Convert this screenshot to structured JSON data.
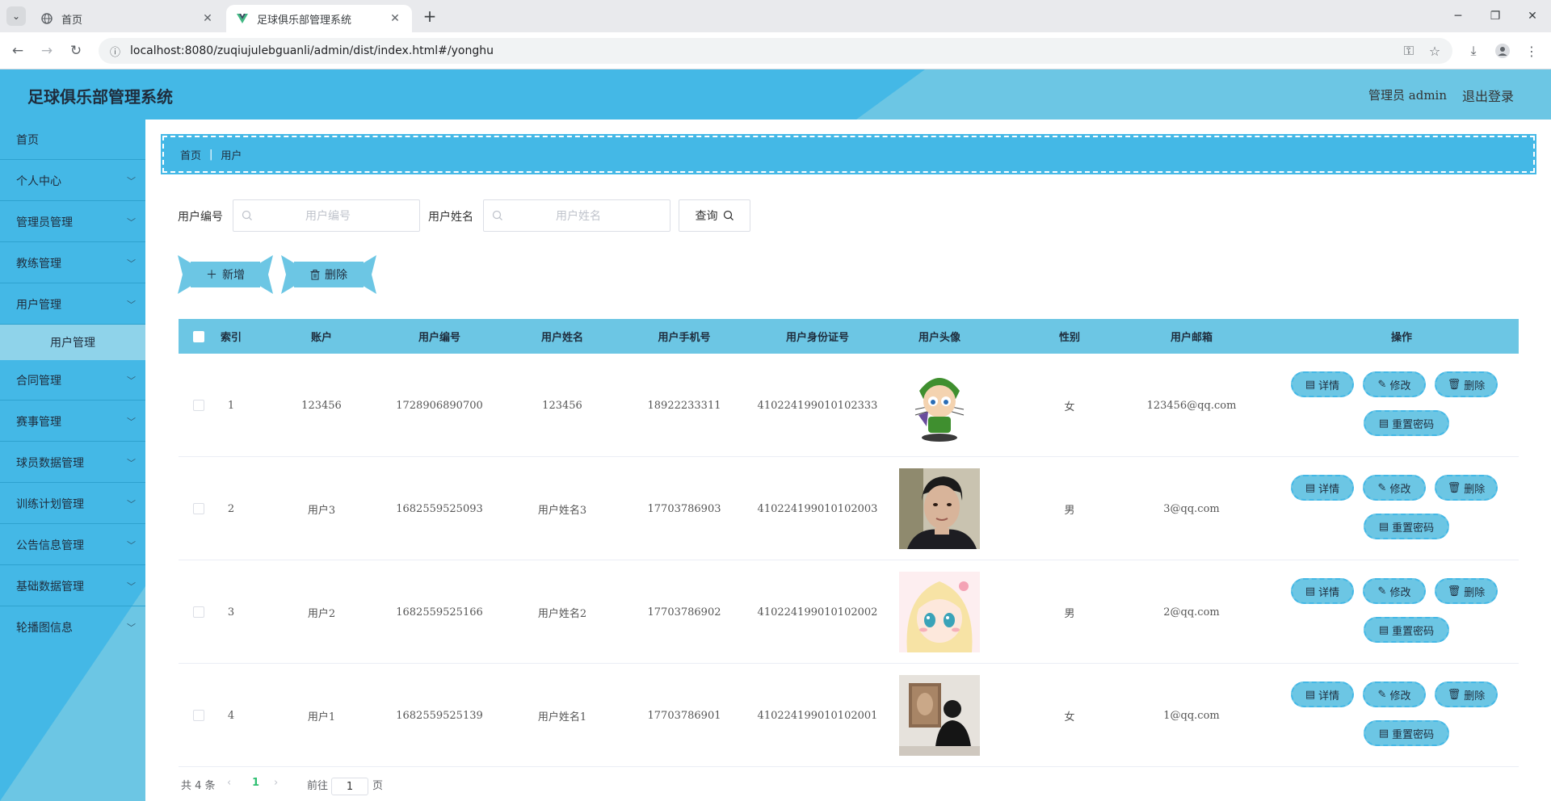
{
  "browser": {
    "tabs": [
      {
        "title": "首页",
        "active": false
      },
      {
        "title": "足球俱乐部管理系统",
        "active": true
      }
    ],
    "url": "localhost:8080/zuqiujulebguanli/admin/dist/index.html#/yonghu"
  },
  "header": {
    "title": "足球俱乐部管理系统",
    "user": "管理员 admin",
    "logout": "退出登录"
  },
  "sidebar": {
    "items": [
      {
        "label": "首页",
        "expandable": false
      },
      {
        "label": "个人中心",
        "expandable": true
      },
      {
        "label": "管理员管理",
        "expandable": true
      },
      {
        "label": "教练管理",
        "expandable": true
      },
      {
        "label": "用户管理",
        "expandable": true,
        "expanded": true
      },
      {
        "label": "合同管理",
        "expandable": true
      },
      {
        "label": "赛事管理",
        "expandable": true
      },
      {
        "label": "球员数据管理",
        "expandable": true
      },
      {
        "label": "训练计划管理",
        "expandable": true
      },
      {
        "label": "公告信息管理",
        "expandable": true
      },
      {
        "label": "基础数据管理",
        "expandable": true
      },
      {
        "label": "轮播图信息",
        "expandable": true
      }
    ],
    "sub_item": "用户管理"
  },
  "breadcrumb": {
    "home": "首页",
    "current": "用户"
  },
  "search": {
    "code_label": "用户编号",
    "code_placeholder": "用户编号",
    "name_label": "用户姓名",
    "name_placeholder": "用户姓名",
    "query": "查询"
  },
  "actions": {
    "add": "新增",
    "delete": "删除"
  },
  "table": {
    "columns": [
      "索引",
      "账户",
      "用户编号",
      "用户姓名",
      "用户手机号",
      "用户身份证号",
      "用户头像",
      "性别",
      "用户邮箱",
      "操作"
    ],
    "rows": [
      {
        "index": "1",
        "account": "123456",
        "code": "1728906890700",
        "name": "123456",
        "phone": "18922233311",
        "idcard": "410224199010102333",
        "avatar": "cartoon-mascot",
        "gender": "女",
        "email": "123456@qq.com"
      },
      {
        "index": "2",
        "account": "用户3",
        "code": "1682559525093",
        "name": "用户姓名3",
        "phone": "17703786903",
        "idcard": "410224199010102003",
        "avatar": "man-portrait",
        "gender": "男",
        "email": "3@qq.com"
      },
      {
        "index": "3",
        "account": "用户2",
        "code": "1682559525166",
        "name": "用户姓名2",
        "phone": "17703786902",
        "idcard": "410224199010102002",
        "avatar": "anime-girl",
        "gender": "男",
        "email": "2@qq.com"
      },
      {
        "index": "4",
        "account": "用户1",
        "code": "1682559525139",
        "name": "用户姓名1",
        "phone": "17703786901",
        "idcard": "410224199010102001",
        "avatar": "person-gallery",
        "gender": "女",
        "email": "1@qq.com"
      }
    ],
    "row_actions": {
      "detail": "详情",
      "edit": "修改",
      "delete": "删除",
      "reset": "重置密码"
    }
  },
  "pager": {
    "total": "共 4 条",
    "current": "1",
    "goto_prefix": "前往",
    "goto_value": "1",
    "goto_suffix": "页"
  },
  "colors": {
    "primary": "#44b8e6",
    "light": "#6cc6e4",
    "active_page": "#2fbf71"
  }
}
